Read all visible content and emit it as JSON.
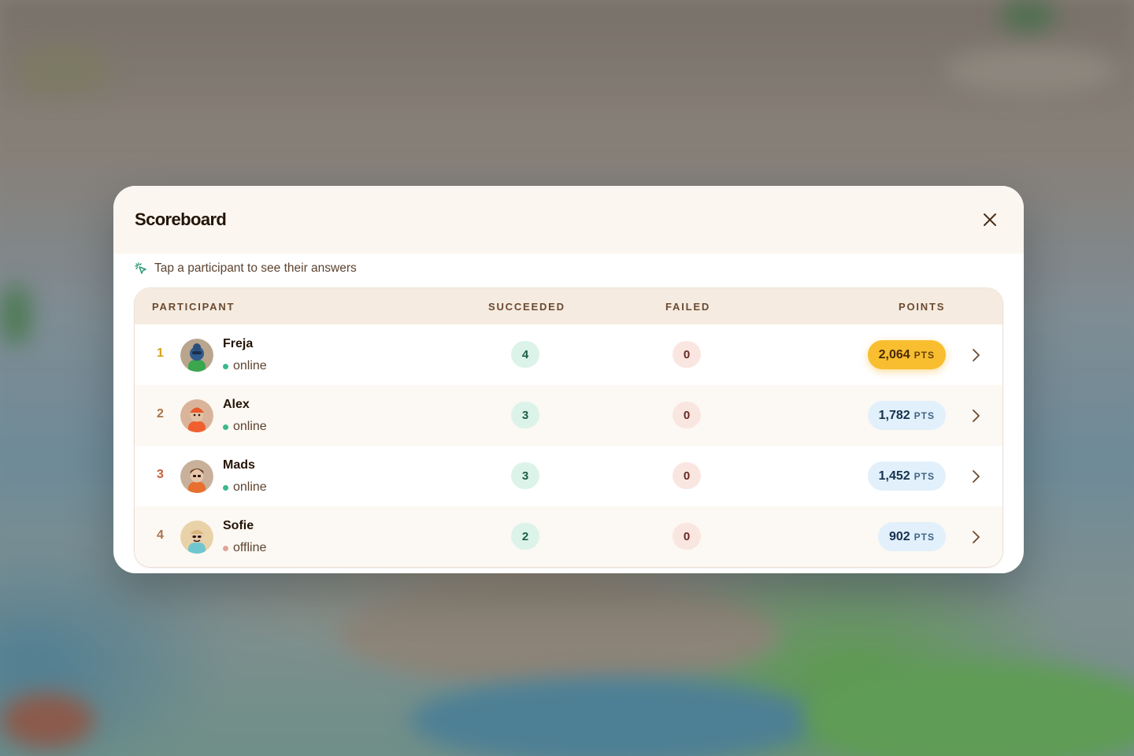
{
  "backdrop": {
    "description_icon": "blurred-game-map"
  },
  "modal": {
    "title": "Scoreboard",
    "close_icon": "close-icon",
    "hint": {
      "icon": "tap-sparkle-icon",
      "text": "Tap a participant to see their answers"
    }
  },
  "table": {
    "headers": {
      "participant": "PARTICIPANT",
      "succeeded": "SUCCEEDED",
      "failed": "FAILED",
      "points": "POINTS"
    },
    "rows": [
      {
        "rank": "1",
        "name": "Freja",
        "status": "online",
        "succeeded": "4",
        "failed": "0",
        "points": "2,064",
        "points_unit": "PTS"
      },
      {
        "rank": "2",
        "name": "Alex",
        "status": "online",
        "succeeded": "3",
        "failed": "0",
        "points": "1,782",
        "points_unit": "PTS"
      },
      {
        "rank": "3",
        "name": "Mads",
        "status": "online",
        "succeeded": "3",
        "failed": "0",
        "points": "1,452",
        "points_unit": "PTS"
      },
      {
        "rank": "4",
        "name": "Sofie",
        "status": "offline",
        "succeeded": "2",
        "failed": "0",
        "points": "902",
        "points_unit": "PTS"
      }
    ]
  },
  "colors": {
    "rank_1": "#d9a21b",
    "rank_2": "#a8754c",
    "rank_3": "#c8603a",
    "rank_4": "#a8754c",
    "online_dot": "#3bb98a",
    "offline_dot": "#e0a596",
    "gold_pill": "#f8be2f",
    "blue_pill": "#e2f0fb"
  }
}
